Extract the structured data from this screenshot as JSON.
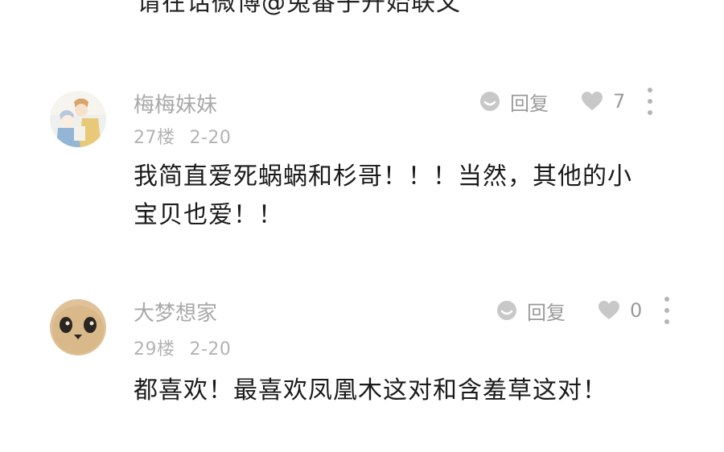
{
  "top_text": "请在话微博@兔番子开始联文",
  "comments": [
    {
      "username": "梅梅妹妹",
      "floor": "27楼",
      "date": "2-20",
      "reply_label": "回复",
      "like_count": "7",
      "text_lines": [
        "我简直爱死蜗蜗和杉哥！！！当然，其他的小",
        "宝贝也爱！！"
      ]
    },
    {
      "username": "大梦想家",
      "floor": "29楼",
      "date": "2-20",
      "reply_label": "回复",
      "like_count": "0",
      "text_lines": [
        "都喜欢！最喜欢凤凰木这对和含羞草这对！"
      ]
    }
  ]
}
